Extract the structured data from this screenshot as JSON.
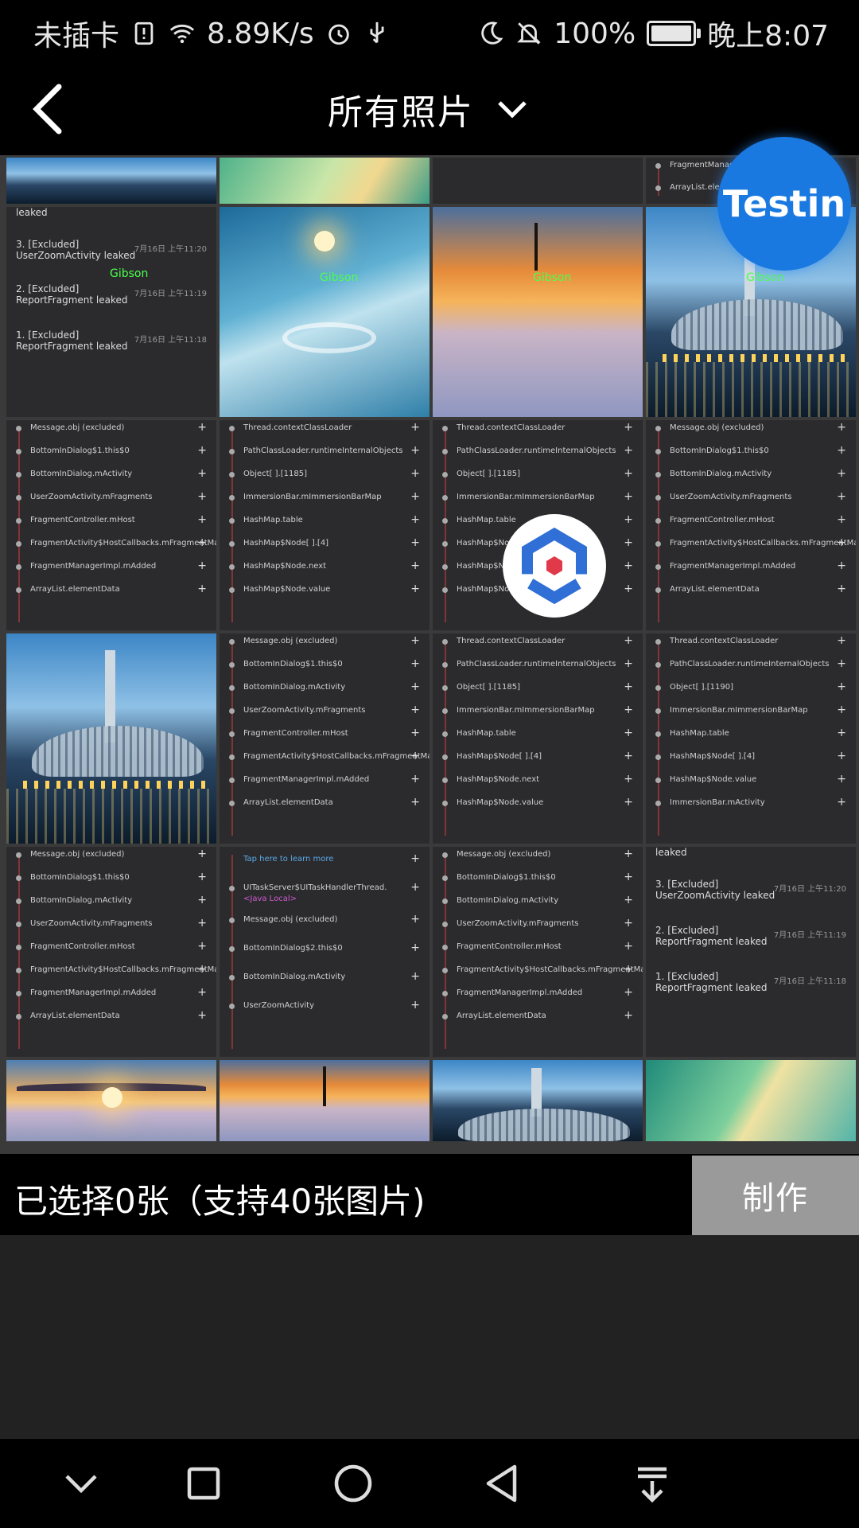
{
  "status_bar": {
    "carrier": "未插卡",
    "net_speed": "8.89K/s",
    "battery": "100%",
    "time": "晚上8:07",
    "icons": [
      "sim-alert-icon",
      "wifi-icon",
      "alarm-icon",
      "usb-icon",
      "moon-icon",
      "mute-bell-icon",
      "battery-icon"
    ]
  },
  "header": {
    "title": "所有照片",
    "back_icon": "back-arrow-icon",
    "dropdown_icon": "chevron-down-icon"
  },
  "overlay": {
    "testin_label": "Testin",
    "logo_icon": "hexagon-logo-icon"
  },
  "photo_text": {
    "leaked": "leaked",
    "excluded3": "3. [Excluded]",
    "excluded3_desc": "UserZoomActivity leaked",
    "excluded2": "2. [Excluded]",
    "excluded1": "1. [Excluded]",
    "fragment_desc": "ReportFragment leaked",
    "time3": "7月16日 上午11:20",
    "time2": "7月16日 上午11:19",
    "time1": "7月16日 上午11:18",
    "watermark": "Gibson",
    "tap_learn": "Tap here to learn more",
    "thread_handler": "UITaskServer$UITaskHandlerThread.",
    "java_local": "<Java Local>",
    "rows_a": [
      "Message.obj (excluded)",
      "BottomInDialog$1.this$0",
      "BottomInDialog.mActivity",
      "UserZoomActivity.mFragments",
      "FragmentController.mHost",
      "FragmentActivity$HostCallbacks.mFragmentManager",
      "FragmentManagerImpl.mAdded",
      "ArrayList.elementData"
    ],
    "rows_b": [
      "Thread.contextClassLoader",
      "PathClassLoader.runtimeInternalObjects",
      "Object[ ].[1185]",
      "ImmersionBar.mImmersionBarMap",
      "HashMap.table",
      "HashMap$Node[ ].[4]",
      "HashMap$Node.next",
      "HashMap$Node.value"
    ],
    "rows_c": [
      "Thread.contextClassLoader",
      "PathClassLoader.runtimeInternalObjects",
      "Object[ ].[1190]",
      "ImmersionBar.mImmersionBarMap",
      "HashMap.table",
      "HashMap$Node[ ].[4]",
      "HashMap$Node.value",
      "ImmersionBar.mActivity"
    ],
    "rows_d": [
      "Message.obj (excluded)",
      "BottomInDialog$2.this$0",
      "BottomInDialog.mActivity",
      "UserZoomActivity"
    ],
    "fragment_manager_short": "FragmentManager",
    "frag_mgr_item": "FragmentManagerImpl",
    "arraylist_short": "ArrayList.ele"
  },
  "selection": {
    "label": "已选择0张（支持40张图片)",
    "make_button": "制作"
  },
  "nav_bar": {
    "buttons": [
      "chevron-down-icon",
      "square-recent-icon",
      "circle-home-icon",
      "triangle-back-icon",
      "notification-pull-icon"
    ]
  },
  "colors": {
    "accent_blue": "#1979e0",
    "make_button_bg": "#9a9a9a",
    "watermark_green": "#4cff4c"
  }
}
